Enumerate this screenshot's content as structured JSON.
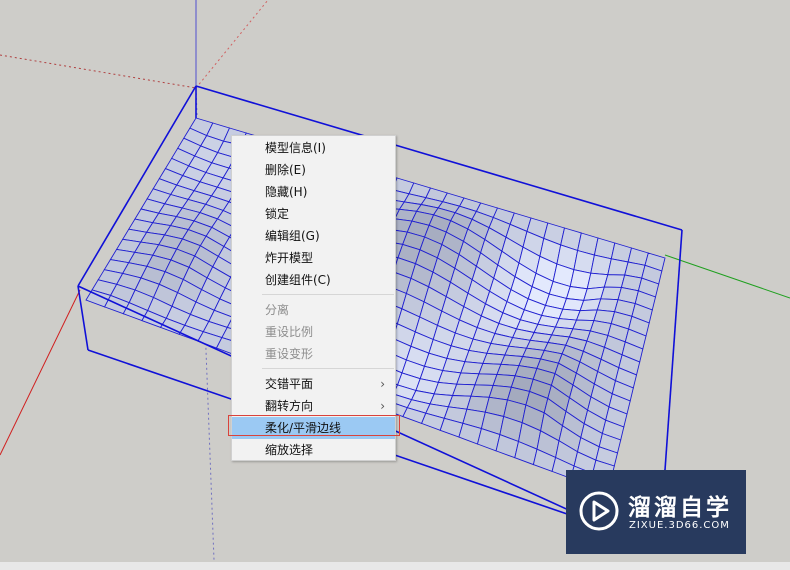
{
  "menu": {
    "items": [
      {
        "label": "模型信息(I)",
        "enabled": true,
        "submenu": false
      },
      {
        "label": "删除(E)",
        "enabled": true,
        "submenu": false
      },
      {
        "label": "隐藏(H)",
        "enabled": true,
        "submenu": false
      },
      {
        "label": "锁定",
        "enabled": true,
        "submenu": false
      },
      {
        "label": "编辑组(G)",
        "enabled": true,
        "submenu": false
      },
      {
        "label": "炸开模型",
        "enabled": true,
        "submenu": false
      },
      {
        "label": "创建组件(C)",
        "enabled": true,
        "submenu": false
      },
      {
        "label": "分离",
        "enabled": false,
        "submenu": false
      },
      {
        "label": "重设比例",
        "enabled": false,
        "submenu": false
      },
      {
        "label": "重设变形",
        "enabled": false,
        "submenu": false
      },
      {
        "label": "交错平面",
        "enabled": true,
        "submenu": true
      },
      {
        "label": "翻转方向",
        "enabled": true,
        "submenu": true
      },
      {
        "label": "柔化/平滑边线",
        "enabled": true,
        "submenu": false,
        "highlighted": true
      },
      {
        "label": "缩放选择",
        "enabled": true,
        "submenu": false
      }
    ],
    "submenu_arrow": "›"
  },
  "watermark": {
    "title": "溜溜自学",
    "url": "ZIXUE.3D66.COM",
    "icon": "play-icon"
  },
  "colors": {
    "viewport_bg": "#cecdc9",
    "selection_blue": "#1010d8",
    "axis_red": "#d02020",
    "axis_green": "#20a020",
    "menu_highlight": "#9bc9f3",
    "highlight_frame": "#d9433c",
    "watermark_bg": "#283a5e"
  }
}
